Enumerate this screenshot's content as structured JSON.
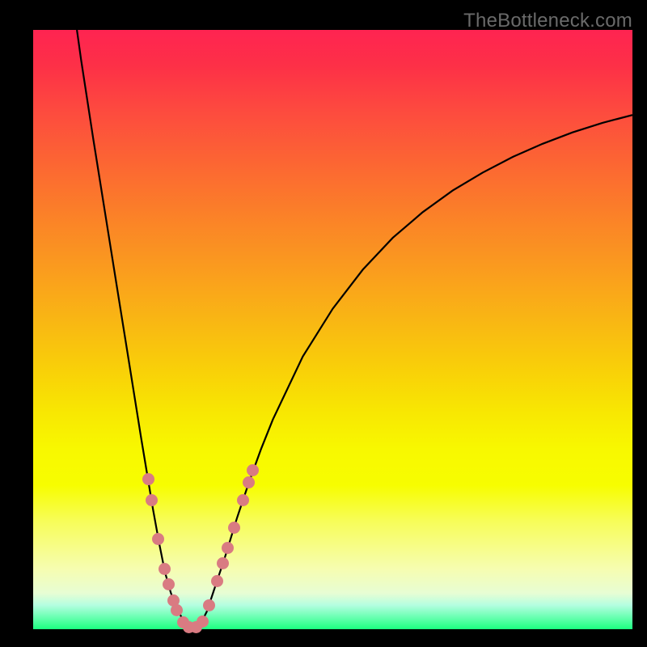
{
  "watermark": "TheBottleneck.com",
  "colors": {
    "dot": "#d97b82",
    "curve": "#000000",
    "frame": "#000000"
  },
  "chart_data": {
    "type": "line",
    "title": "",
    "xlabel": "",
    "ylabel": "",
    "xlim": [
      0,
      100
    ],
    "ylim": [
      0,
      100
    ],
    "note": "Axes are unlabeled; values below are estimated positions in the 0–100 plot coordinate space read from pixel positions.",
    "series": [
      {
        "name": "left-branch",
        "x": [
          7.3,
          8.0,
          10.0,
          12.0,
          14.0,
          16.0,
          18.0,
          20.0,
          21.0,
          22.0,
          23.0,
          24.0,
          25.0,
          25.5,
          26.0,
          26.5
        ],
        "y": [
          100.0,
          95.0,
          82.0,
          69.5,
          57.0,
          44.5,
          32.0,
          20.0,
          14.5,
          9.5,
          6.0,
          3.5,
          1.5,
          0.8,
          0.3,
          0.1
        ]
      },
      {
        "name": "right-branch",
        "x": [
          27.0,
          27.5,
          28.0,
          29.0,
          30.0,
          32.0,
          34.0,
          36.0,
          38.0,
          40.0,
          45.0,
          50.0,
          55.0,
          60.0,
          65.0,
          70.0,
          75.0,
          80.0,
          85.0,
          90.0,
          95.0,
          100.0
        ],
        "y": [
          0.1,
          0.4,
          1.0,
          3.0,
          6.0,
          12.0,
          18.5,
          24.5,
          30.0,
          35.0,
          45.5,
          53.5,
          60.0,
          65.3,
          69.6,
          73.2,
          76.2,
          78.8,
          81.0,
          82.9,
          84.5,
          85.8
        ]
      }
    ],
    "highlight_points": {
      "name": "highlighted-dots",
      "points": [
        {
          "x": 19.2,
          "y": 25.0
        },
        {
          "x": 19.8,
          "y": 21.5
        },
        {
          "x": 20.9,
          "y": 15.0
        },
        {
          "x": 21.9,
          "y": 10.0
        },
        {
          "x": 22.6,
          "y": 7.5
        },
        {
          "x": 23.4,
          "y": 4.8
        },
        {
          "x": 23.9,
          "y": 3.2
        },
        {
          "x": 25.0,
          "y": 1.2
        },
        {
          "x": 26.0,
          "y": 0.3
        },
        {
          "x": 27.2,
          "y": 0.3
        },
        {
          "x": 28.3,
          "y": 1.3
        },
        {
          "x": 29.3,
          "y": 4.0
        },
        {
          "x": 30.7,
          "y": 8.0
        },
        {
          "x": 31.7,
          "y": 11.0
        },
        {
          "x": 32.4,
          "y": 13.5
        },
        {
          "x": 33.6,
          "y": 17.0
        },
        {
          "x": 35.0,
          "y": 21.5
        },
        {
          "x": 36.0,
          "y": 24.5
        },
        {
          "x": 36.7,
          "y": 26.5
        }
      ]
    }
  }
}
